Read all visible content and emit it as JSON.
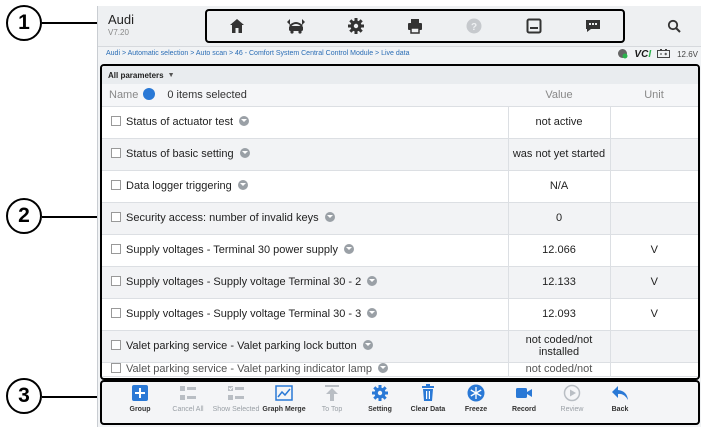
{
  "callouts": [
    "1",
    "2",
    "3"
  ],
  "header": {
    "brand": "Audi",
    "version": "V7.20",
    "toolbar_icons": [
      "home-icon",
      "vehicle-swap-icon",
      "gear-icon",
      "printer-icon",
      "help-icon",
      "save-icon",
      "message-icon"
    ]
  },
  "breadcrumb": "Audi > Automatic selection > Auto scan > 46 - Comfort System Central Control Module > Live data",
  "status": {
    "vci_prefix": "VC",
    "vci_suffix": "I",
    "voltage": "12.6V"
  },
  "filter": {
    "label": "All parameters",
    "caret": "▼"
  },
  "table": {
    "header": {
      "name": "Name",
      "selected": "0 items selected",
      "value": "Value",
      "unit": "Unit"
    },
    "rows": [
      {
        "name": "Status of actuator test",
        "value": "not active",
        "unit": ""
      },
      {
        "name": "Status of basic setting",
        "value": "was not yet started",
        "unit": ""
      },
      {
        "name": "Data logger triggering",
        "value": "N/A",
        "unit": ""
      },
      {
        "name": "Security access: number of invalid keys",
        "value": "0",
        "unit": ""
      },
      {
        "name": "Supply voltages - Terminal 30 power supply",
        "value": "12.066",
        "unit": "V"
      },
      {
        "name": "Supply voltages - Supply voltage Terminal 30 - 2",
        "value": "12.133",
        "unit": "V"
      },
      {
        "name": "Supply voltages - Supply voltage Terminal 30 - 3",
        "value": "12.093",
        "unit": "V"
      },
      {
        "name": "Valet parking service - Valet parking lock button",
        "value": "not coded/not installed",
        "unit": ""
      }
    ],
    "partial_row": {
      "name": "Valet parking service - Valet parking indicator lamp",
      "value": "not coded/not"
    }
  },
  "functions": [
    {
      "label": "Group",
      "icon": "group-icon",
      "enabled": true
    },
    {
      "label": "Cancel All",
      "icon": "cancel-all-icon",
      "enabled": false
    },
    {
      "label": "Show Selected",
      "icon": "show-selected-icon",
      "enabled": false
    },
    {
      "label": "Graph Merge",
      "icon": "graph-merge-icon",
      "enabled": true
    },
    {
      "label": "To Top",
      "icon": "to-top-icon",
      "enabled": false
    },
    {
      "label": "Setting",
      "icon": "setting-icon",
      "enabled": true
    },
    {
      "label": "Clear Data",
      "icon": "clear-data-icon",
      "enabled": true
    },
    {
      "label": "Freeze",
      "icon": "freeze-icon",
      "enabled": true
    },
    {
      "label": "Record",
      "icon": "record-icon",
      "enabled": true
    },
    {
      "label": "Review",
      "icon": "review-icon",
      "enabled": false
    },
    {
      "label": "Back",
      "icon": "back-icon",
      "enabled": true
    }
  ],
  "colors": {
    "accent": "#2a79d6",
    "frame": "#000000",
    "link": "#2a6db5",
    "vci_green": "#2bb24c"
  }
}
